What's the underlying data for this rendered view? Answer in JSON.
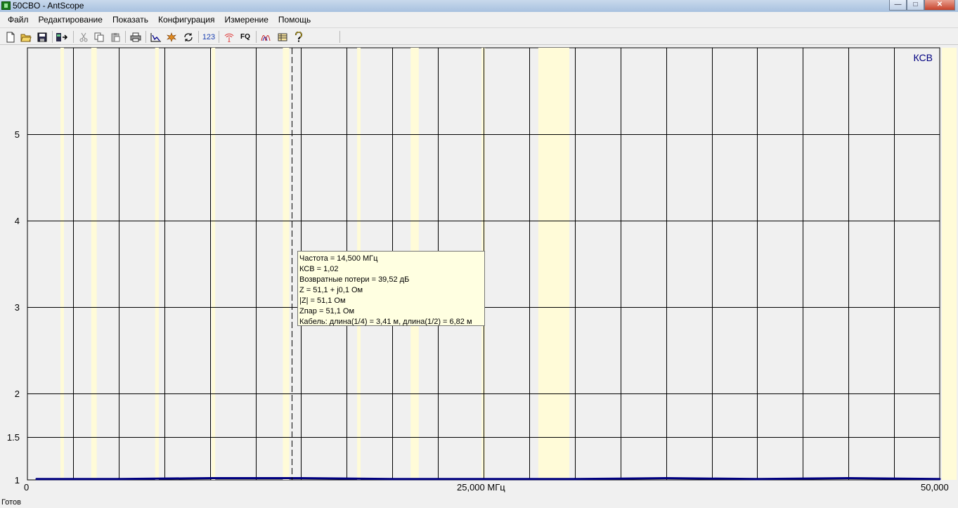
{
  "window": {
    "title": "50CBO - AntScope",
    "minimize": "—",
    "maximize": "□",
    "close": "✕"
  },
  "menu": [
    "Файл",
    "Редактирование",
    "Показать",
    "Конфигурация",
    "Измерение",
    "Помощь"
  ],
  "toolbar": {
    "icons": [
      "new-file-icon",
      "open-folder-icon",
      "save-icon",
      "export-icon",
      "cut-icon",
      "copy-icon",
      "paste-icon",
      "print-icon",
      "graph-icon",
      "scan-icon",
      "refresh-icon",
      "numbers-icon",
      "antenna-icon",
      "frequency-icon",
      "smith-icon",
      "table-icon",
      "help-icon"
    ],
    "numbers_label": "123",
    "fq_label": "FQ"
  },
  "chart": {
    "series_label": "КСВ",
    "y_ticks": [
      "1",
      "1.5",
      "2",
      "3",
      "4",
      "5"
    ],
    "x_start": "0",
    "x_mid": "25,000 МГц",
    "x_end": "50,000",
    "colors": {
      "plot_bg": "#f0f0f0",
      "band": "#fffbd8",
      "grid": "#000000",
      "trace": "#000080",
      "label": "#000080"
    }
  },
  "chart_data": {
    "type": "line",
    "title": "",
    "xlabel": "МГц",
    "ylabel": "",
    "xlim": [
      0,
      50
    ],
    "ylim": [
      1,
      6
    ],
    "y_ticks": [
      1,
      1.5,
      2,
      3,
      4,
      5
    ],
    "x": [
      0.5,
      5,
      10,
      15,
      20,
      25,
      30,
      35,
      40,
      45,
      50
    ],
    "series": [
      {
        "name": "КСВ",
        "values": [
          1.01,
          1.01,
          1.02,
          1.02,
          1.01,
          1.01,
          1.01,
          1.02,
          1.01,
          1.02,
          1.01
        ]
      }
    ],
    "bands_mhz": [
      [
        1.81,
        2.0
      ],
      [
        3.5,
        3.8
      ],
      [
        7.0,
        7.2
      ],
      [
        10.1,
        10.15
      ],
      [
        14.0,
        14.35
      ],
      [
        18.068,
        18.168
      ],
      [
        21.0,
        21.45
      ],
      [
        24.89,
        24.99
      ],
      [
        28.0,
        29.7
      ]
    ],
    "cursor_mhz": 14.5,
    "grid": true
  },
  "tooltip": {
    "lines": [
      "Частота = 14,500 МГц",
      "КСВ = 1,02",
      "Возвратные потери = 39,52 дБ",
      "Z = 51,1 + j0,1 Ом",
      "|Z| = 51,1 Ом",
      "Zпар = 51,1 Ом",
      "Кабель: длина(1/4) = 3,41 м, длина(1/2) = 6,82 м"
    ]
  },
  "status": "Готов"
}
